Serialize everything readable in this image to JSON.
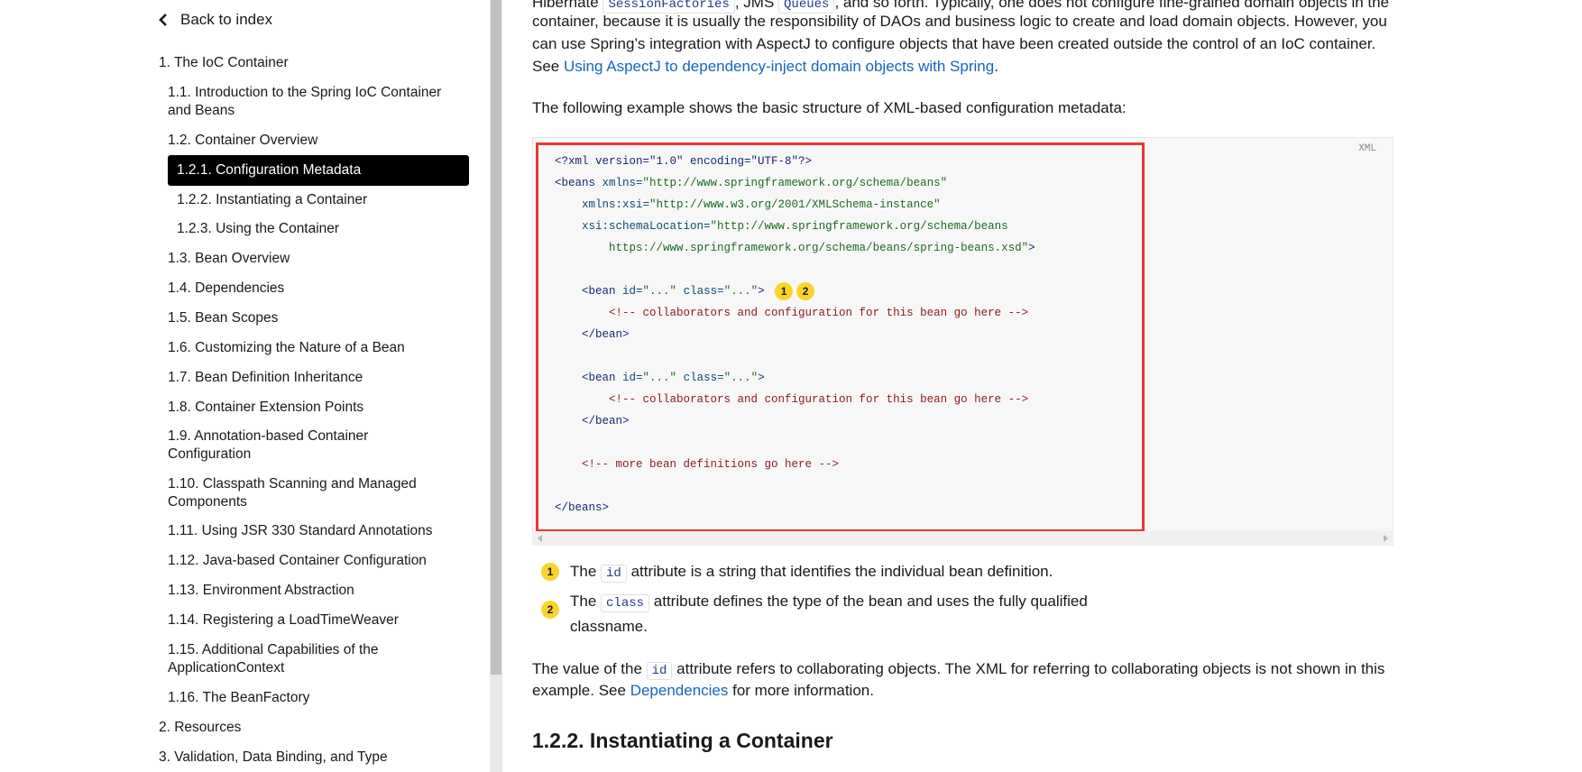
{
  "sidebar": {
    "back_label": "Back to index",
    "items": [
      {
        "label": "1. The IoC Container"
      },
      {
        "label": "1.1. Introduction to the Spring IoC Container"
      },
      {
        "label": "and Beans"
      },
      {
        "label": "1.2. Container Overview"
      },
      {
        "label": "1.2.1. Configuration Metadata"
      },
      {
        "label": "1.2.2. Instantiating a Container"
      },
      {
        "label": "1.2.3. Using the Container"
      },
      {
        "label": "1.3. Bean Overview"
      },
      {
        "label": "1.4. Dependencies"
      },
      {
        "label": "1.5. Bean Scopes"
      },
      {
        "label": "1.6. Customizing the Nature of a Bean"
      },
      {
        "label": "1.7. Bean Definition Inheritance"
      },
      {
        "label": "1.8. Container Extension Points"
      },
      {
        "label": "1.9. Annotation-based Container"
      },
      {
        "label": "Configuration"
      },
      {
        "label": "1.10. Classpath Scanning and Managed"
      },
      {
        "label": "Components"
      },
      {
        "label": "1.11. Using JSR 330 Standard Annotations"
      },
      {
        "label": "1.12. Java-based Container Configuration"
      },
      {
        "label": "1.13. Environment Abstraction"
      },
      {
        "label": "1.14. Registering a LoadTimeWeaver"
      },
      {
        "label": "1.15. Additional Capabilities of the"
      },
      {
        "label": "ApplicationContext"
      },
      {
        "label": "1.16. The BeanFactory"
      },
      {
        "label": "2. Resources"
      },
      {
        "label": "3. Validation, Data Binding, and Type"
      }
    ],
    "active_index": 4
  },
  "main": {
    "intro": {
      "line1_a": "Hibernate ",
      "code1": "SessionFactories",
      "line1_b": ", JMS ",
      "code2": "Queues",
      "line1_c": ", and so forth. Typically, one does not configure fine-grained domain objects in the",
      "line2": "container, because it is usually the responsibility of DAOs and business logic to create and load domain objects. However, you",
      "line3": "can use Spring’s integration with AspectJ to configure objects that have been created outside the control of an IoC container.",
      "line4_a": "See ",
      "line4_link": "Using AspectJ to dependency-inject domain objects with Spring",
      "line4_b": "."
    },
    "example_intro": "The following example shows the basic structure of XML-based configuration metadata:",
    "code": {
      "lang": "XML",
      "l1": "<?xml version=\"1.0\" encoding=\"UTF-8\"?>",
      "l2_tag": "<beans ",
      "l2_attr": "xmlns=",
      "l2_str": "\"http://www.springframework.org/schema/beans\"",
      "l3_attr": "xmlns:xsi=",
      "l3_str": "\"http://www.w3.org/2001/XMLSchema-instance\"",
      "l4_attr": "xsi:schemaLocation=",
      "l4_str": "\"http://www.springframework.org/schema/beans",
      "l5_str": "https://www.springframework.org/schema/beans/spring-beans.xsd\"",
      "l5_tag": ">",
      "bean_open_a": "<bean ",
      "bean_id_attr": "id=",
      "bean_id_str": "\"...\"",
      "bean_class_attr": " class=",
      "bean_class_str": "\"...\"",
      "bean_open_end": ">",
      "comment1": "<!-- collaborators and configuration for this bean go here -->",
      "bean_close": "</bean>",
      "comment2": "<!-- more bean definitions go here -->",
      "beans_close": "</beans>",
      "callout1": "1",
      "callout2": "2"
    },
    "notes": [
      {
        "num": "1",
        "a": "The ",
        "code": "id",
        "b": " attribute is a string that identifies the individual bean definition."
      },
      {
        "num": "2",
        "a": "The ",
        "code": "class",
        "b": " attribute defines the type of the bean and uses the fully qualified",
        "c": "classname."
      }
    ],
    "value_para": {
      "a": "The value of the ",
      "code": "id",
      "b": " attribute refers to collaborating objects. The XML for referring to collaborating objects is not shown in this",
      "c_a": "example. See ",
      "c_link": "Dependencies",
      "c_b": " for more information."
    },
    "next_heading": "1.2.2. Instantiating a Container"
  }
}
